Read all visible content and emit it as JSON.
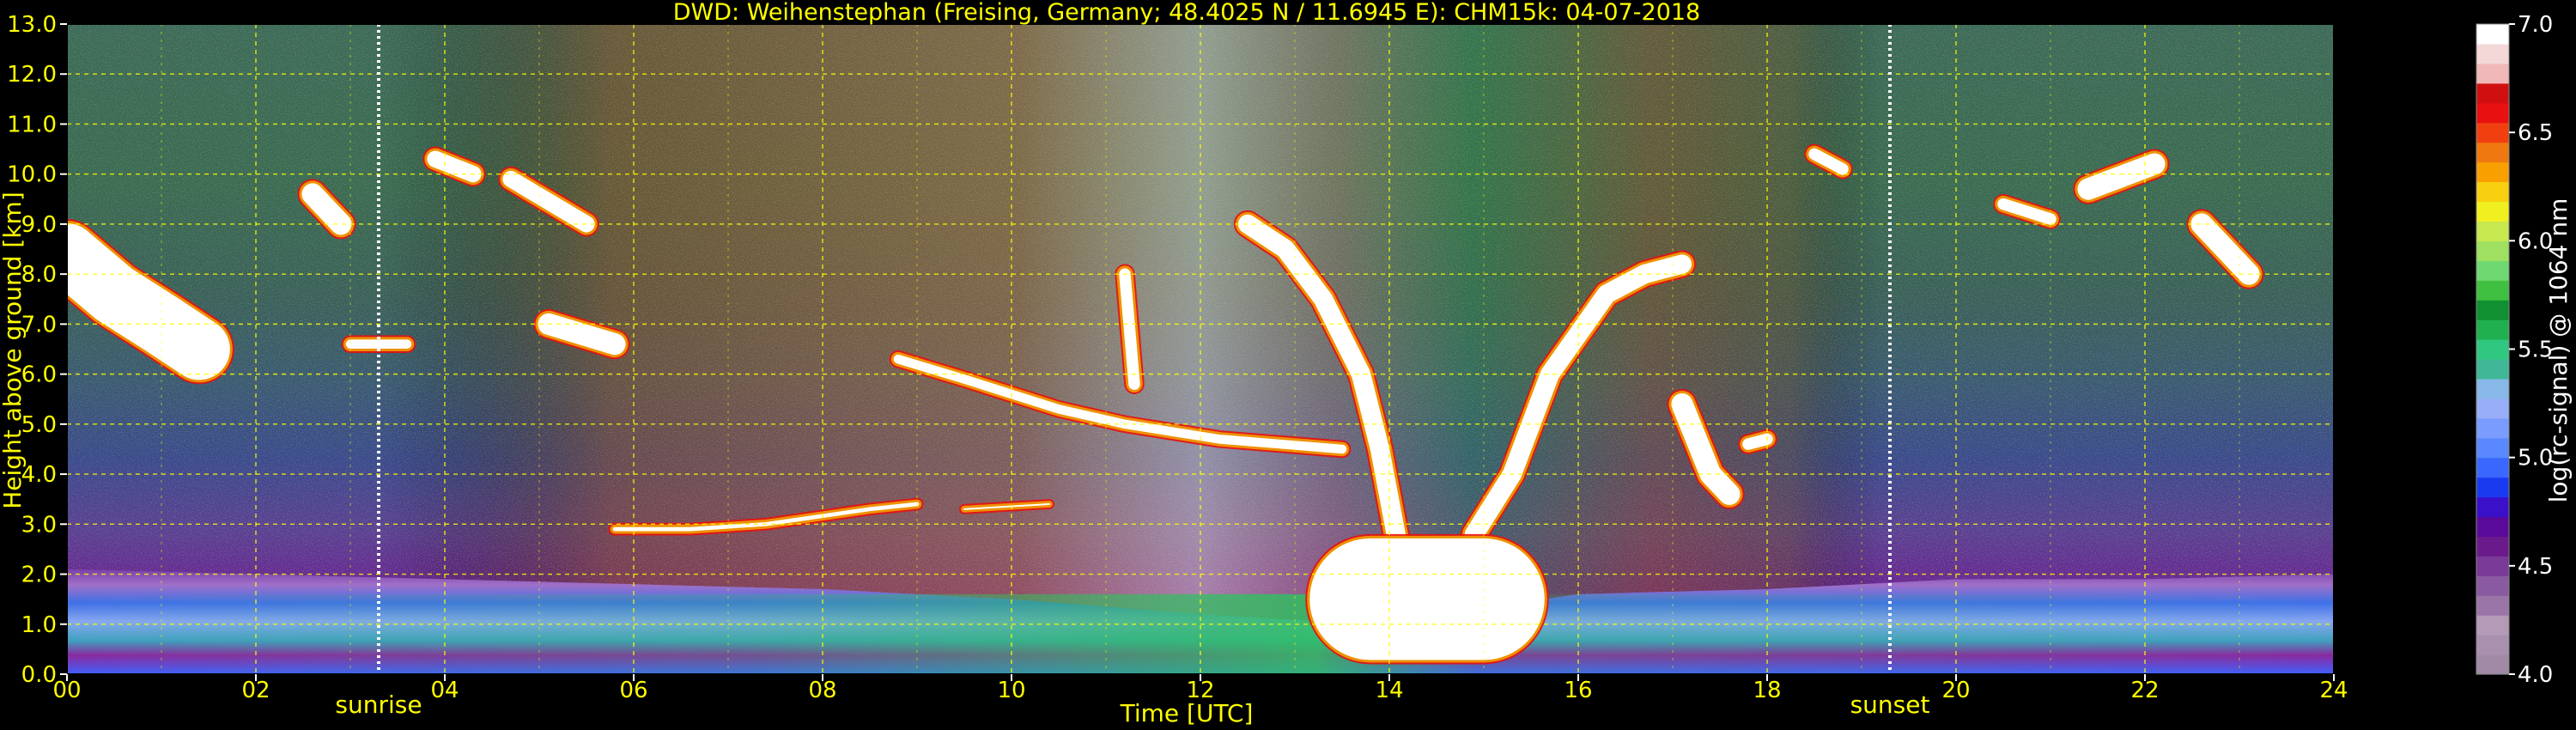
{
  "chart_data": {
    "type": "heatmap",
    "title": "DWD: Weihenstephan (Freising, Germany; 48.4025 N / 11.6945 E):    CHM15k: 04-07-2018",
    "xlabel": "Time [UTC]",
    "ylabel": "Height above ground [km]",
    "x_ticks": [
      "00",
      "02",
      "04",
      "06",
      "08",
      "10",
      "12",
      "14",
      "16",
      "18",
      "20",
      "22",
      "24"
    ],
    "y_ticks": [
      "0.0",
      "1.0",
      "2.0",
      "3.0",
      "4.0",
      "5.0",
      "6.0",
      "7.0",
      "8.0",
      "9.0",
      "10.0",
      "11.0",
      "12.0",
      "13.0"
    ],
    "xlim": [
      0,
      24
    ],
    "ylim": [
      0,
      13
    ],
    "grid": true,
    "colorbar": {
      "label": "log(rc-signal) @ 1064 nm",
      "range": [
        4.0,
        7.0
      ],
      "ticks": [
        "4.0",
        "4.5",
        "5.0",
        "5.5",
        "6.0",
        "6.5",
        "7.0"
      ],
      "colors": [
        "#a08aa6",
        "#a890ae",
        "#b59ab8",
        "#9a76a8",
        "#8a5aa0",
        "#7a3a98",
        "#6a1a8a",
        "#5a0a9a",
        "#3a10c8",
        "#1a3af0",
        "#3a68ff",
        "#5a88ff",
        "#7a9cff",
        "#98aef8",
        "#88b8e8",
        "#40b898",
        "#30c880",
        "#20b050",
        "#109030",
        "#40c040",
        "#70d870",
        "#a0e060",
        "#c8e850",
        "#f0f020",
        "#f8d010",
        "#f8a000",
        "#f07810",
        "#f04010",
        "#e81010",
        "#d01010",
        "#f0b8b8",
        "#f4d8d8",
        "#ffffff"
      ]
    },
    "events": [
      {
        "name": "sunrise",
        "time": 3.3
      },
      {
        "name": "sunset",
        "time": 19.3
      }
    ],
    "layers": {
      "boundary_layer_top": [
        [
          0,
          2.1
        ],
        [
          2,
          2.0
        ],
        [
          4,
          1.9
        ],
        [
          6,
          1.8
        ],
        [
          8,
          1.7
        ],
        [
          10,
          1.5
        ],
        [
          12,
          1.2
        ],
        [
          13.8,
          1.0
        ],
        [
          16,
          1.6
        ],
        [
          18,
          1.7
        ],
        [
          20,
          1.9
        ],
        [
          22,
          1.9
        ],
        [
          24,
          2.0
        ]
      ],
      "cloud_segments": [
        {
          "points": [
            [
              0,
              8.4
            ],
            [
              0.5,
              7.6
            ],
            [
              1.0,
              7.0
            ],
            [
              1.4,
              6.5
            ]
          ],
          "thickness": 1.3
        },
        {
          "points": [
            [
              3.0,
              6.6
            ],
            [
              3.5,
              6.6
            ],
            [
              3.6,
              6.6
            ]
          ],
          "thickness": 0.25
        },
        {
          "points": [
            [
              2.6,
              9.6
            ],
            [
              2.9,
              9.0
            ]
          ],
          "thickness": 0.5
        },
        {
          "points": [
            [
              3.9,
              10.3
            ],
            [
              4.3,
              10.0
            ]
          ],
          "thickness": 0.4
        },
        {
          "points": [
            [
              4.7,
              9.9
            ],
            [
              5.5,
              9.0
            ]
          ],
          "thickness": 0.4
        },
        {
          "points": [
            [
              5.1,
              7.0
            ],
            [
              5.8,
              6.6
            ]
          ],
          "thickness": 0.5
        },
        {
          "points": [
            [
              5.8,
              2.9
            ],
            [
              6.6,
              2.9
            ],
            [
              7.4,
              3.0
            ],
            [
              8.5,
              3.3
            ],
            [
              9.0,
              3.4
            ]
          ],
          "thickness": 0.15
        },
        {
          "points": [
            [
              9.5,
              3.3
            ],
            [
              10.4,
              3.4
            ]
          ],
          "thickness": 0.1
        },
        {
          "points": [
            [
              8.8,
              6.3
            ],
            [
              9.5,
              5.9
            ],
            [
              10.5,
              5.3
            ],
            [
              11.2,
              5.0
            ],
            [
              12.2,
              4.7
            ],
            [
              13.5,
              4.5
            ]
          ],
          "thickness": 0.25
        },
        {
          "points": [
            [
              11.2,
              8.0
            ],
            [
              11.3,
              5.8
            ]
          ],
          "thickness": 0.3
        },
        {
          "points": [
            [
              12.5,
              9.0
            ],
            [
              12.9,
              8.5
            ],
            [
              13.3,
              7.5
            ],
            [
              13.7,
              6.0
            ],
            [
              13.9,
              4.5
            ],
            [
              14.1,
              2.5
            ]
          ],
          "thickness": 0.45
        },
        {
          "points": [
            [
              14.9,
              2.8
            ],
            [
              15.3,
              4.0
            ],
            [
              15.7,
              6.0
            ],
            [
              16.3,
              7.6
            ],
            [
              16.7,
              8.0
            ],
            [
              17.1,
              8.2
            ]
          ],
          "thickness": 0.45
        },
        {
          "points": [
            [
              13.8,
              1.5
            ],
            [
              14.4,
              1.5
            ],
            [
              15.0,
              1.5
            ]
          ],
          "thickness": 2.5
        },
        {
          "points": [
            [
              17.1,
              5.4
            ],
            [
              17.4,
              4.0
            ],
            [
              17.6,
              3.6
            ]
          ],
          "thickness": 0.5
        },
        {
          "points": [
            [
              17.8,
              4.6
            ],
            [
              18.0,
              4.7
            ]
          ],
          "thickness": 0.3
        },
        {
          "points": [
            [
              18.5,
              10.4
            ],
            [
              18.8,
              10.1
            ]
          ],
          "thickness": 0.3
        },
        {
          "points": [
            [
              20.5,
              9.4
            ],
            [
              21.0,
              9.1
            ]
          ],
          "thickness": 0.3
        },
        {
          "points": [
            [
              21.4,
              9.7
            ],
            [
              22.1,
              10.2
            ]
          ],
          "thickness": 0.5
        },
        {
          "points": [
            [
              22.6,
              9.0
            ],
            [
              23.1,
              8.0
            ]
          ],
          "thickness": 0.5
        }
      ]
    }
  }
}
